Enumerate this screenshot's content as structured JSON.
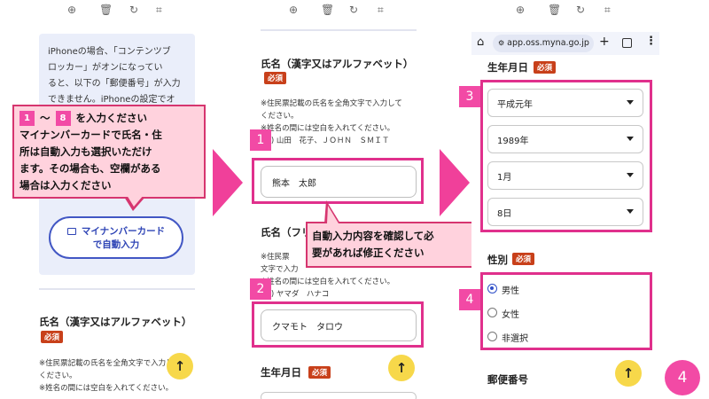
{
  "toolbar": {
    "icons": [
      "zoom-icon",
      "trash-icon",
      "rotate-icon",
      "crop-icon"
    ]
  },
  "panel1": {
    "info_lines": [
      "iPhoneの場合、「コンテンツブ",
      "ロッカー」がオンになってい",
      "ると、以下の「郵便番号」が入力",
      "できません。iPhoneの設定でオ"
    ],
    "mynumber_button": [
      "マイナンバーカード",
      "で自動入力"
    ],
    "name_label": "氏名（漢字又はアルファベット）",
    "required": "必須",
    "notes": [
      "※住民票記載の氏名を全角文字で入力して",
      "ください。",
      "※姓名の間には空白を入れてください。"
    ],
    "fab": "↑"
  },
  "callout_main": {
    "range_badge_start": "1",
    "range_tilde": "～",
    "range_badge_end": "8",
    "line1_suffix": "を入力ください",
    "lines": [
      "マイナンバーカードで氏名・住",
      "所は自動入力も選択いただけ",
      "ます。その場合も、空欄がある",
      "場合は入力ください"
    ]
  },
  "panel2": {
    "name_label": "氏名（漢字又はアルファベット）",
    "required": "必須",
    "notes": [
      "※住民票記載の氏名を全角文字で入力して",
      "ください。",
      "※姓名の間には空白を入れてください。",
      "(例) 山田　花子、ＪＯＨＮ　ＳＭＩＴ"
    ],
    "badge1": "1",
    "name_value": "熊本　太郎",
    "kana_label": "氏名（フリ",
    "kana_notes": [
      "※住民票",
      "文字で入力",
      "※姓名の間には空白を入れてください。",
      "(例) ヤマダ　ハナコ"
    ],
    "badge2": "2",
    "kana_value": "クマモト　タロウ",
    "birth_label": "生年月日",
    "required2": "必須",
    "fab": "↑"
  },
  "callout_check": {
    "lines": [
      "自動入力内容を確認して必",
      "要があれば修正ください"
    ]
  },
  "panel3": {
    "url": "app.oss.myna.go.jp",
    "birth_label": "生年月日",
    "required": "必須",
    "badge3": "3",
    "selects": [
      "平成元年",
      "1989年",
      "1月",
      "8日"
    ],
    "gender_label": "性別",
    "required2": "必須",
    "badge4": "4",
    "gender_options": [
      "男性",
      "女性",
      "非選択"
    ],
    "selected_gender": "男性",
    "postal_label": "郵便番号",
    "fab": "↑"
  },
  "corner_badge": "4",
  "colors": {
    "accent_pink": "#f0409a",
    "required_red": "#c8401a",
    "fab_yellow": "#f7d84a",
    "callout_bg": "#ffd2dd",
    "radio_blue": "#2f4fc8"
  }
}
